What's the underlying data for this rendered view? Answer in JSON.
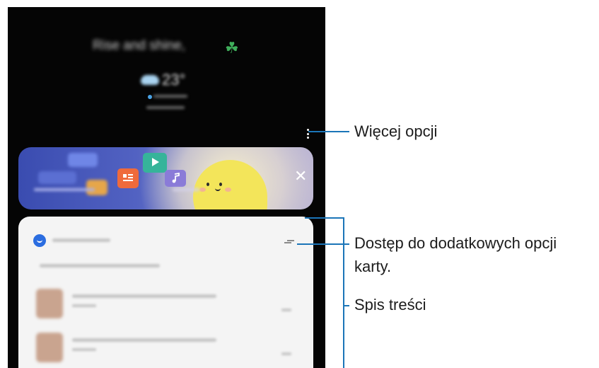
{
  "screen": {
    "greeting": "Rise and shine, ",
    "greeting_emoji": "☘",
    "temperature": "23°",
    "close_glyph": "✕",
    "icon_names": [
      "weather-cloud-icon",
      "location-pin-icon",
      "more-options-icon",
      "close-icon",
      "app-logo-icon",
      "card-options-icon"
    ]
  },
  "callouts": {
    "more_options": "Więcej opcji",
    "card_options_line1": "Dostęp do dodatkowych opcji",
    "card_options_line2": "karty.",
    "content_list": "Spis treści"
  },
  "colors": {
    "callout_line": "#1b75b8",
    "banner_start": "#3a4cb0",
    "banner_blob": "#f3e55a",
    "card_logo": "#2b6de0"
  }
}
